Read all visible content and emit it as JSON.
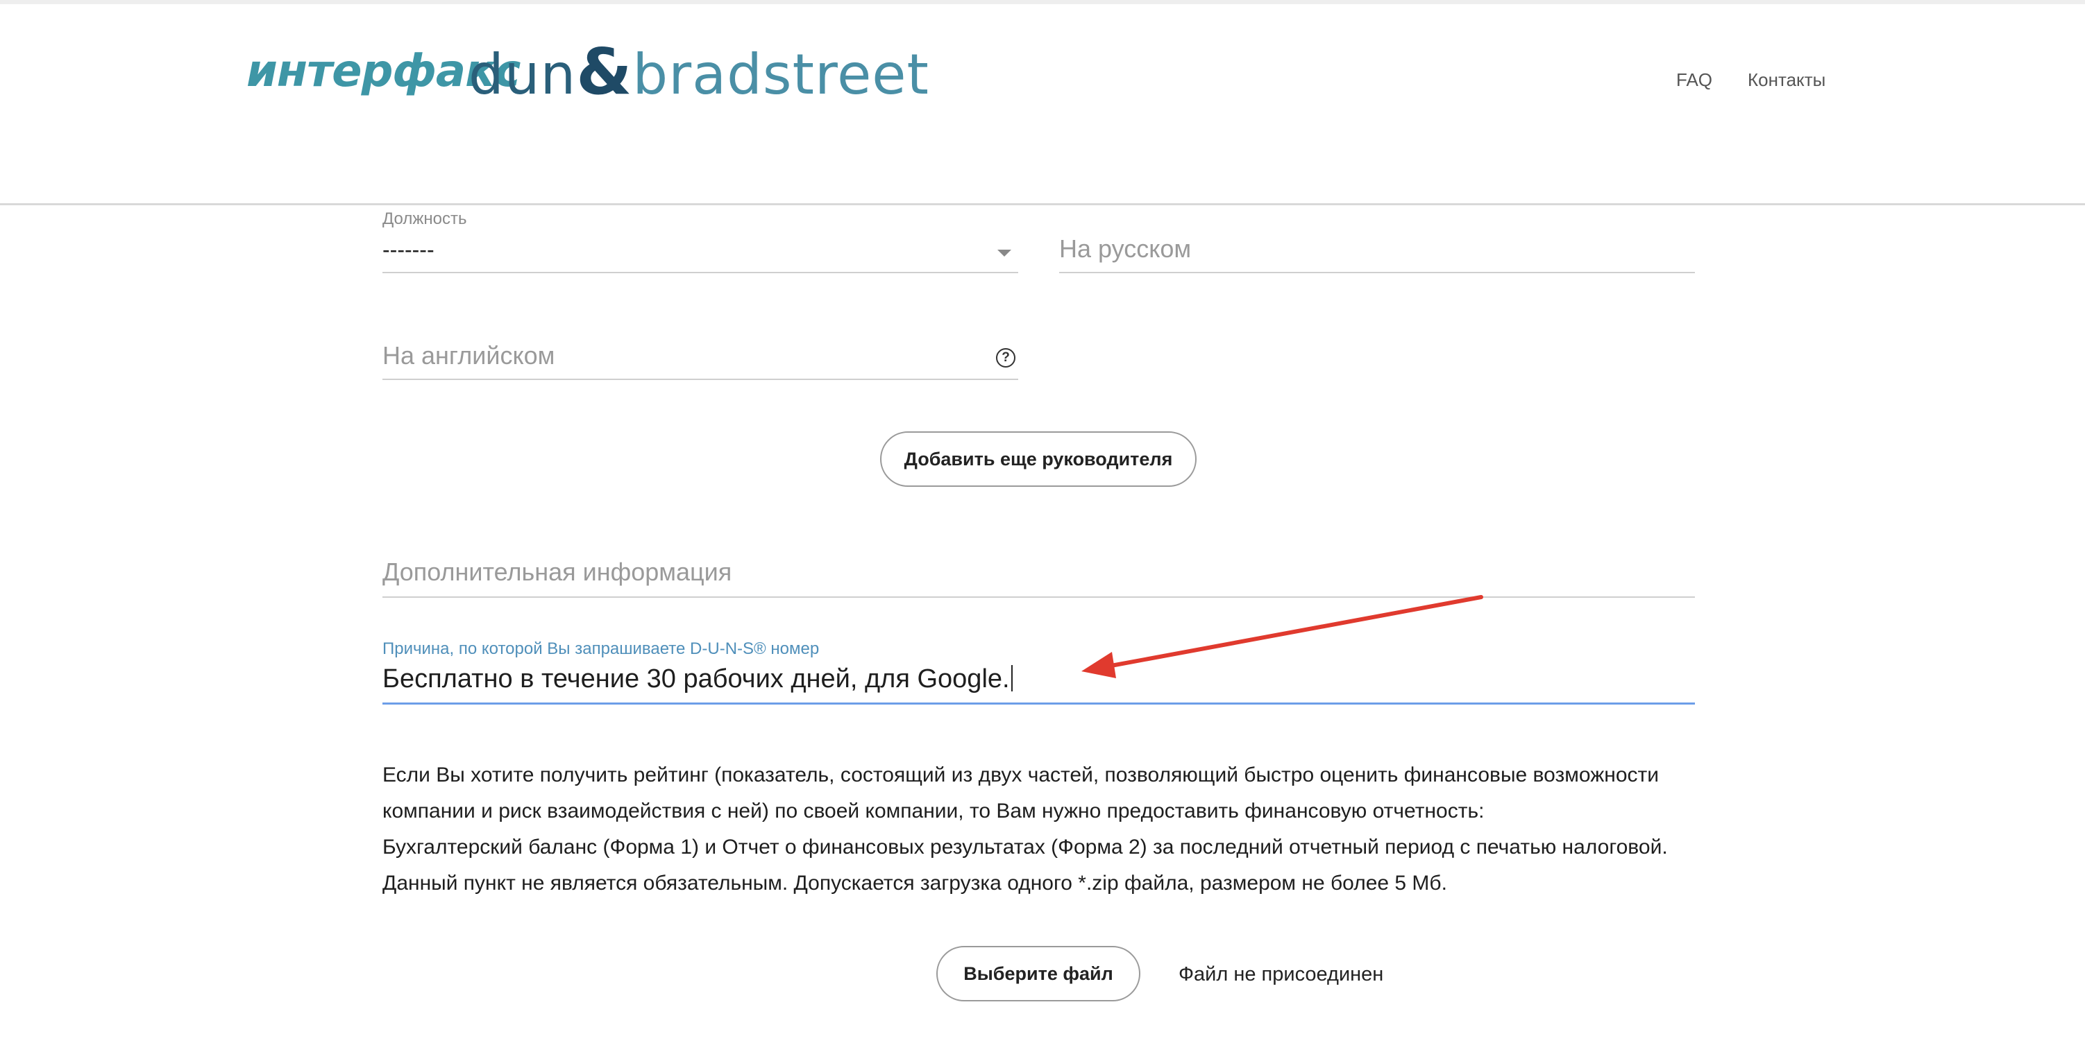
{
  "header": {
    "logo_interfax": "интерфакс",
    "logo_dnb_dun": "dun",
    "logo_dnb_amp": "&",
    "logo_dnb_bradstreet": "bradstreet",
    "nav": {
      "faq": "FAQ",
      "contacts": "Контакты"
    }
  },
  "form": {
    "position": {
      "label": "Должность",
      "selected": "-------"
    },
    "russian": {
      "placeholder": "На русском"
    },
    "english": {
      "placeholder": "На английском",
      "help": "?"
    },
    "add_manager_button": "Добавить еще руководителя",
    "additional_info": {
      "placeholder": "Дополнительная информация"
    },
    "reason": {
      "label": "Причина, по которой Вы запрашиваете D-U-N-S® номер",
      "value": "Бесплатно в течение 30 рабочих дней, для Google."
    },
    "info_lines": [
      "Если Вы хотите получить рейтинг (показатель, состоящий из двух частей, позволяющий быстро оценить финансовые возможности",
      "компании и риск взаимодействия с ней) по своей компании, то Вам нужно предоставить финансовую отчетность:",
      "Бухгалтерский баланс (Форма 1) и Отчет о финансовых результатах (Форма 2) за последний отчетный период с печатью налоговой.",
      "Данный пункт не является обязательным. Допускается загрузка одного *.zip файла, размером не более 5 Мб."
    ],
    "choose_file_button": "Выберите файл",
    "file_status": "Файл не присоединен"
  },
  "annotation": {
    "arrow_color": "#e03a2e"
  },
  "colors": {
    "brand_teal": "#3e96a6",
    "brand_navy": "#1f4a66",
    "active_underline": "#6d9ee8",
    "label_blue": "#4f8fba"
  }
}
